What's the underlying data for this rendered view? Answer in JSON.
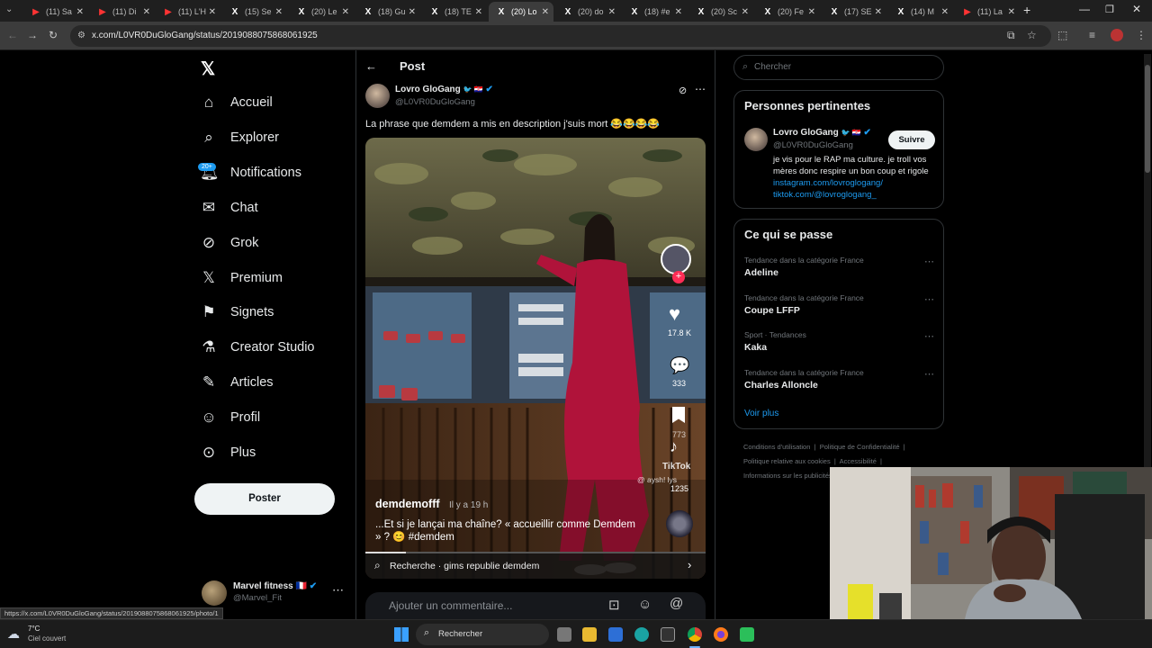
{
  "browser": {
    "tabs": [
      {
        "icon": "youtube",
        "label": "(11) Sa"
      },
      {
        "icon": "youtube",
        "label": "(11) Di"
      },
      {
        "icon": "youtube",
        "label": "(11) L'H"
      },
      {
        "icon": "x",
        "label": "(15) Se"
      },
      {
        "icon": "x",
        "label": "(20) Le"
      },
      {
        "icon": "x",
        "label": "(18) Gu"
      },
      {
        "icon": "x",
        "label": "(18) TE"
      },
      {
        "icon": "x",
        "label": "(20) Lo",
        "active": true
      },
      {
        "icon": "x",
        "label": "(20) do"
      },
      {
        "icon": "x",
        "label": "(18) #e"
      },
      {
        "icon": "x",
        "label": "(20) Sc"
      },
      {
        "icon": "x",
        "label": "(20) Fe"
      },
      {
        "icon": "x",
        "label": "(17) SE"
      },
      {
        "icon": "x",
        "label": "(14) M"
      },
      {
        "icon": "youtube",
        "label": "(11) La"
      }
    ],
    "url": "x.com/L0VR0DuGloGang/status/2019088075868061925"
  },
  "sidebar": {
    "items": [
      {
        "label": "Accueil",
        "icon": "home-icon"
      },
      {
        "label": "Explorer",
        "icon": "search-icon"
      },
      {
        "label": "Notifications",
        "icon": "bell-icon",
        "badge": "20+"
      },
      {
        "label": "Chat",
        "icon": "mail-icon"
      },
      {
        "label": "Grok",
        "icon": "grok-icon"
      },
      {
        "label": "Premium",
        "icon": "x-logo-icon"
      },
      {
        "label": "Signets",
        "icon": "bookmark-icon"
      },
      {
        "label": "Creator Studio",
        "icon": "flask-icon"
      },
      {
        "label": "Articles",
        "icon": "article-icon"
      },
      {
        "label": "Profil",
        "icon": "person-icon"
      },
      {
        "label": "Plus",
        "icon": "more-circle-icon"
      }
    ],
    "post_button": "Poster",
    "account": {
      "name": "Marvel fitness",
      "flag": "🇫🇷",
      "handle": "@Marvel_Fit"
    }
  },
  "post": {
    "header": "Post",
    "author": {
      "name": "Lovro GloGang",
      "emoji": "🐦 🇭🇷",
      "handle": "@L0VR0DuGloGang"
    },
    "text": "La phrase que demdem a mis en description j'suis mort 😂😂😂😂",
    "video": {
      "creator": "demdemofff",
      "time": "Il y a 19 h",
      "caption": "...Et si je lançai ma chaîne? « accueillir comme Demdem » ? 😊 #demdem",
      "likes": "17.8 K",
      "comments": "333",
      "bookmarks": "773",
      "shares": "1235",
      "watermark": "TikTok",
      "watermark_user": "@ aysh! lys",
      "search": "Recherche · gims republie demdem",
      "comment_placeholder": "Ajouter un commentaire..."
    }
  },
  "right": {
    "search_placeholder": "Chercher",
    "relevant": {
      "title": "Personnes pertinentes",
      "name": "Lovro GloGang",
      "emoji": "🐦 🇭🇷",
      "handle": "@L0VR0DuGloGang",
      "follow": "Suivre",
      "bio": "je vis pour le RAP ma culture. je troll vos mères donc respire un bon coup et rigole ",
      "link1": "instagram.com/lovroglogang/",
      "link2": "tiktok.com/@lovroglogang_"
    },
    "trends": {
      "title": "Ce qui se passe",
      "items": [
        {
          "category": "Tendance dans la catégorie France",
          "name": "Adeline"
        },
        {
          "category": "Tendance dans la catégorie France",
          "name": "Coupe LFFP"
        },
        {
          "category": "Sport · Tendances",
          "name": "Kaka"
        },
        {
          "category": "Tendance dans la catégorie France",
          "name": "Charles Alloncle"
        }
      ],
      "more": "Voir plus"
    },
    "footer": [
      "Conditions d'utilisation",
      "Politique de Confidentialité",
      "Politique relative aux cookies",
      "Accessibilité",
      "Informations sur les publicités"
    ]
  },
  "status_url": "https://x.com/L0VR0DuGloGang/status/2019088075868061925/photo/1",
  "taskbar": {
    "weather_temp": "7°C",
    "weather_desc": "Ciel couvert",
    "search": "Rechercher"
  }
}
